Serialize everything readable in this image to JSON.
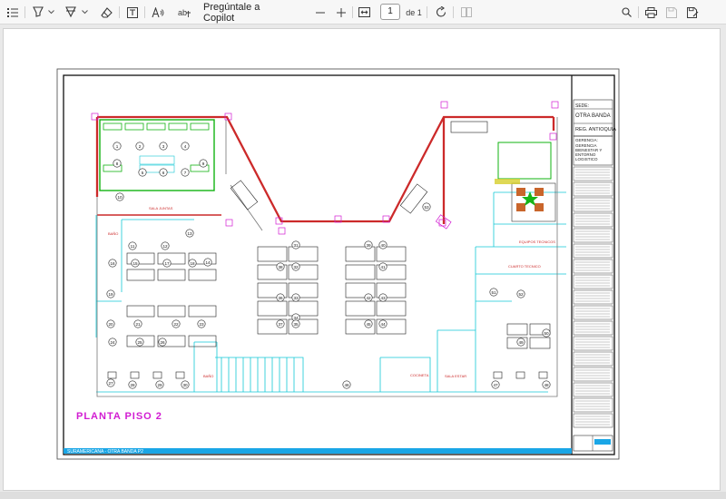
{
  "toolbar": {
    "copilot_label": "Pregúntale a Copilot",
    "page_number": "1",
    "page_total": "de 1"
  },
  "plan": {
    "title": "PLANTA PISO 2",
    "footer_caption": "SURAMERICANA - OTRA BANDA P2",
    "title_block": {
      "sede_label": "SEDE:",
      "sede_value": "OTRA BANDA",
      "region": "REG. ANTIOQUIA",
      "gerencia_label": "GERENCIA:",
      "gerencia_line1": "GERENCIA",
      "gerencia_line2": "BIENESTAR Y",
      "gerencia_line3": "ENTORNO",
      "gerencia_line4": "LOGISTICO"
    },
    "room_labels": {
      "sala_juntas": "SALA JUNTAS",
      "bano": "BAÑO",
      "cocineta": "COCINETA",
      "cuarto_tecnico": "CUARTO TECNICO",
      "equipo_tecnico": "EQUIPOS TECNICOS",
      "sala_estar": "SALA ESTAR",
      "bano2": "BAÑO"
    },
    "workstations": [
      "1",
      "2",
      "3",
      "4",
      "5",
      "6",
      "7",
      "8",
      "9",
      "10",
      "11",
      "12",
      "13",
      "14",
      "15",
      "16",
      "17",
      "18",
      "19",
      "20",
      "21",
      "22",
      "23",
      "24",
      "25",
      "26",
      "27",
      "28",
      "29",
      "30",
      "31",
      "32",
      "33",
      "34",
      "35",
      "36",
      "37",
      "38",
      "39",
      "40",
      "41",
      "42",
      "43",
      "44",
      "45",
      "46",
      "47",
      "48",
      "49",
      "50",
      "51",
      "52",
      "53"
    ]
  },
  "colors": {
    "wall": "#cc2a2a",
    "furniture": "#222222",
    "cyan": "#14c9d6",
    "green": "#12b312",
    "magenta": "#d21cd2",
    "accent_bar": "#1aa6e6"
  }
}
